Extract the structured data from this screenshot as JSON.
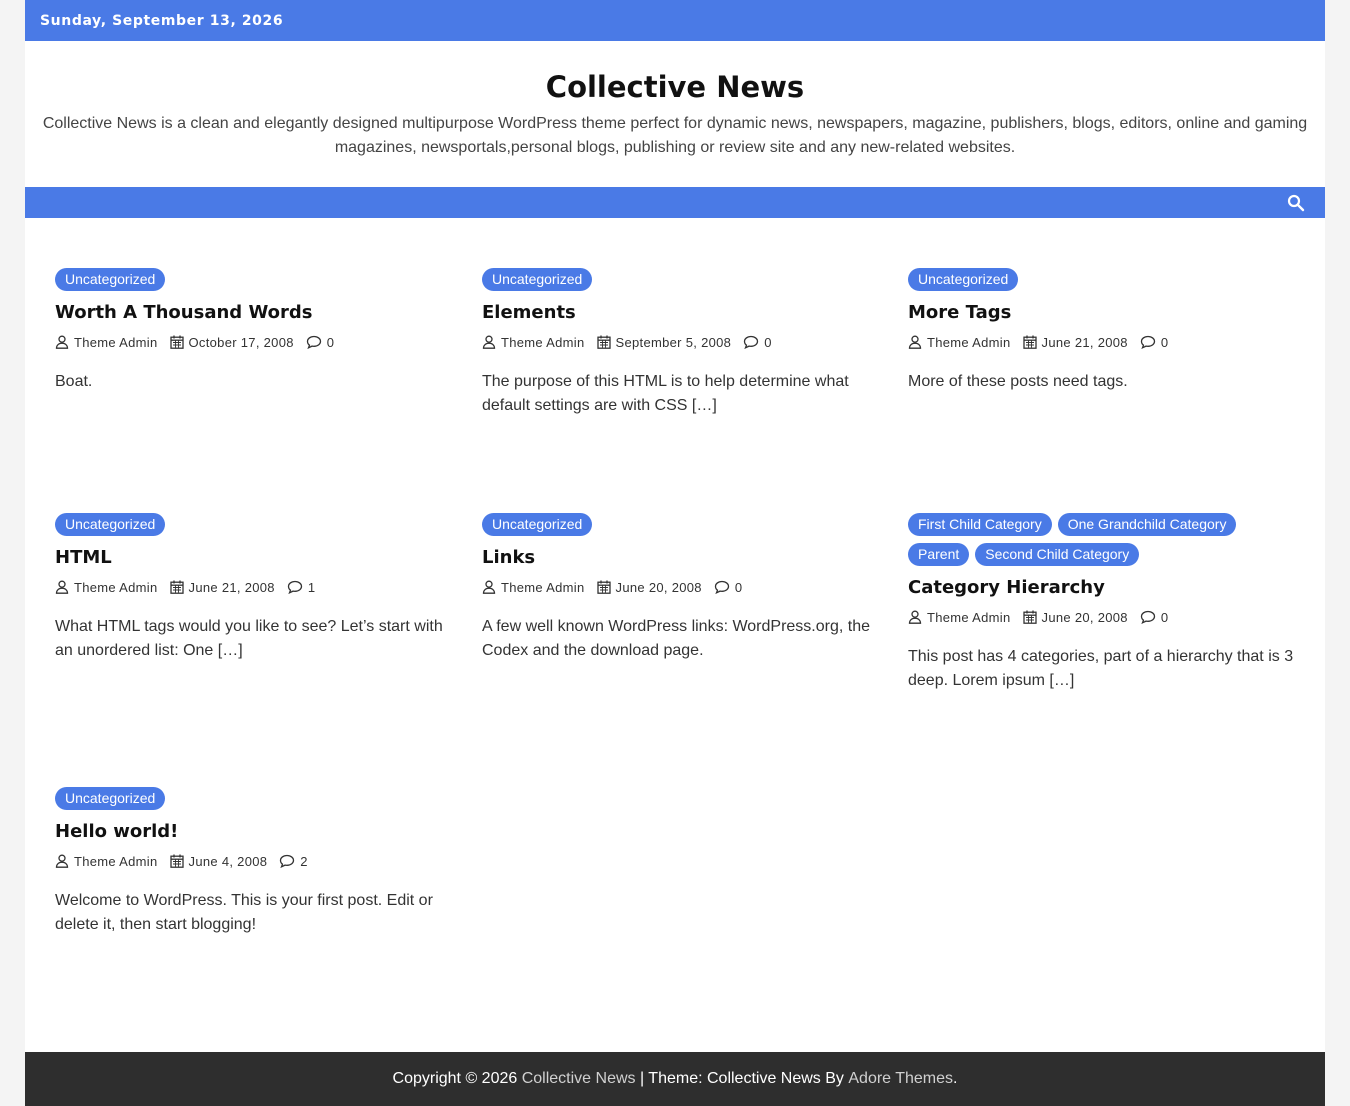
{
  "topbar": {
    "date": "Sunday, September 13, 2026"
  },
  "site": {
    "title": "Collective News",
    "description": "Collective News is a clean and elegantly designed multipurpose WordPress theme perfect for dynamic news, newspapers, magazine, publishers, blogs, editors, online and gaming magazines, newsportals,personal blogs, publishing or review site and any new-related websites."
  },
  "nav": {
    "search_icon": "search-icon"
  },
  "colors": {
    "accent": "#4a7ae6",
    "footer_bg": "#2e2e2e"
  },
  "posts": [
    {
      "categories": [
        "Uncategorized"
      ],
      "title": "Worth A Thousand Words",
      "author": "Theme Admin",
      "date": "October 17, 2008",
      "comments": "0",
      "excerpt": "Boat."
    },
    {
      "categories": [
        "Uncategorized"
      ],
      "title": "Elements",
      "author": "Theme Admin",
      "date": "September 5, 2008",
      "comments": "0",
      "excerpt": "The purpose of this HTML is to help determine what default settings are with CSS […]"
    },
    {
      "categories": [
        "Uncategorized"
      ],
      "title": "More Tags",
      "author": "Theme Admin",
      "date": "June 21, 2008",
      "comments": "0",
      "excerpt": "More of these posts need tags."
    },
    {
      "categories": [
        "Uncategorized"
      ],
      "title": "HTML",
      "author": "Theme Admin",
      "date": "June 21, 2008",
      "comments": "1",
      "excerpt": "What HTML tags would you like to see? Let’s start with an unordered list: One […]"
    },
    {
      "categories": [
        "Uncategorized"
      ],
      "title": "Links",
      "author": "Theme Admin",
      "date": "June 20, 2008",
      "comments": "0",
      "excerpt": "A few well known WordPress links: WordPress.org, the Codex and the download page."
    },
    {
      "categories": [
        "First Child Category",
        "One Grandchild Category",
        "Parent",
        "Second Child Category"
      ],
      "title": "Category Hierarchy",
      "author": "Theme Admin",
      "date": "June 20, 2008",
      "comments": "0",
      "excerpt": "This post has 4 categories, part of a hierarchy that is 3 deep. Lorem ipsum […]"
    },
    {
      "categories": [
        "Uncategorized"
      ],
      "title": "Hello world!",
      "author": "Theme Admin",
      "date": "June 4, 2008",
      "comments": "2",
      "excerpt": "Welcome to WordPress. This is your first post. Edit or delete it, then start blogging!"
    }
  ],
  "footer": {
    "copyright_prefix": "Copyright © 2026",
    "site_link": "Collective News",
    "theme_text": "| Theme: Collective News By",
    "theme_author_link": "Adore Themes",
    "suffix": "."
  }
}
